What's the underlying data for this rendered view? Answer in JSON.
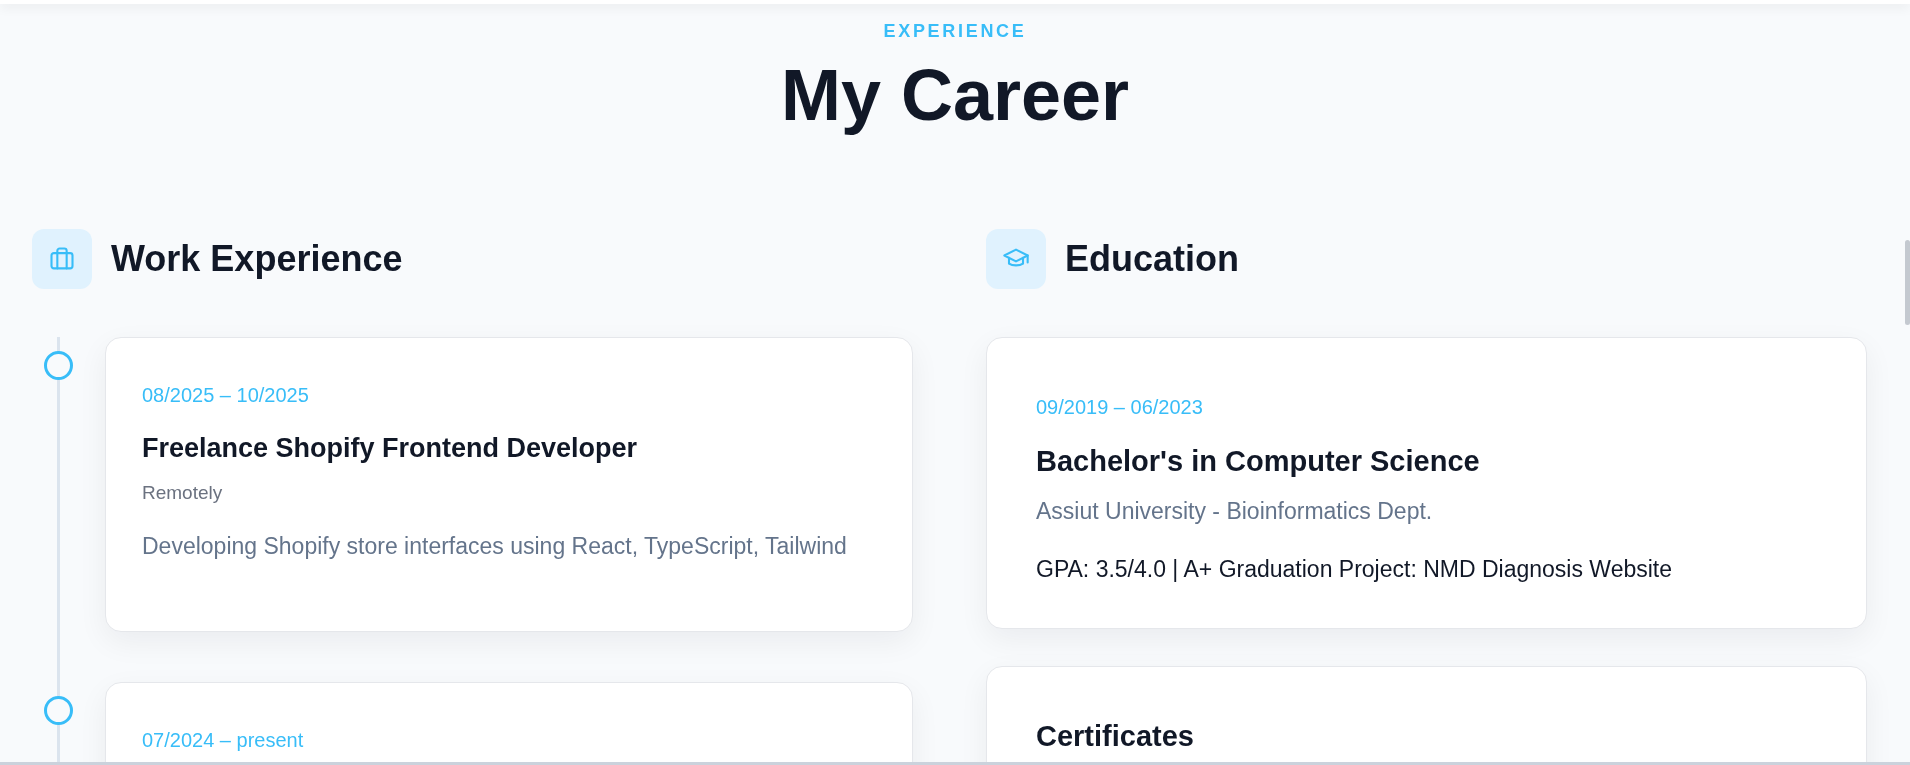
{
  "section_label": "EXPERIENCE",
  "title": "My Career",
  "work": {
    "heading": "Work Experience",
    "items": [
      {
        "date": "08/2025 – 10/2025",
        "title": "Freelance Shopify Frontend Developer",
        "location": "Remotely",
        "description": "Developing Shopify store interfaces using React, TypeScript, Tailwind"
      },
      {
        "date": "07/2024 – present"
      }
    ]
  },
  "education": {
    "heading": "Education",
    "items": [
      {
        "kind": "degree",
        "date": "09/2019 – 06/2023",
        "title": "Bachelor's in Computer Science",
        "subtitle": "Assiut University - Bioinformatics Dept.",
        "details": "GPA: 3.5/4.0 | A+ Graduation Project: NMD Diagnosis Website"
      },
      {
        "kind": "certificates",
        "title": "Certificates"
      }
    ]
  }
}
